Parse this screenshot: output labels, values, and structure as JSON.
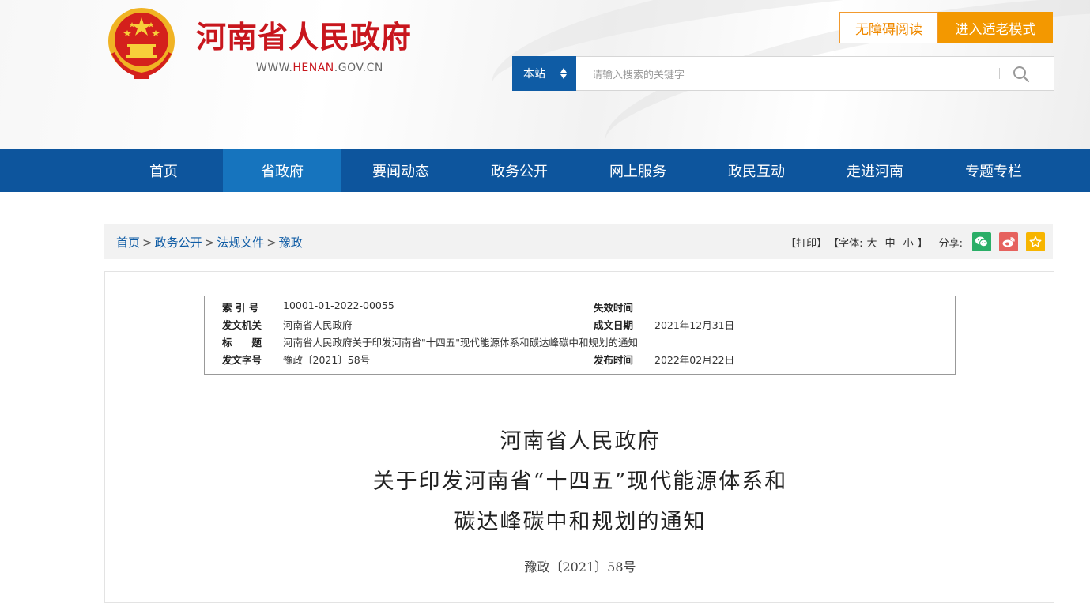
{
  "header": {
    "site_title": "河南省人民政府",
    "url_prefix": "WWW.",
    "url_highlight": "HENAN",
    "url_suffix": ".GOV.CN",
    "accessible_label": "无障碍阅读",
    "elder_mode_label": "进入适老模式",
    "search": {
      "scope": "本站",
      "placeholder": "请输入搜索的关键字"
    }
  },
  "nav": {
    "items": [
      "首页",
      "省政府",
      "要闻动态",
      "政务公开",
      "网上服务",
      "政民互动",
      "走进河南",
      "专题专栏"
    ],
    "active_index": 1
  },
  "breadcrumb": {
    "items": [
      "首页",
      "政务公开",
      "法规文件",
      "豫政"
    ],
    "separator": ">"
  },
  "tools": {
    "print": "【打印】",
    "font_label": "【字体:",
    "font_large": "大",
    "font_medium": "中",
    "font_small": "小",
    "font_close": "】",
    "share_label": "分享:"
  },
  "share_icons": [
    "wechat-icon",
    "weibo-icon",
    "favorite-icon"
  ],
  "colors": {
    "brand_red": "#c8161d",
    "nav_blue": "#0d559d",
    "nav_active": "#1674be",
    "accent_orange": "#f39800",
    "wechat_green": "#2aae67",
    "weibo_red": "#e6625e",
    "favorite_yellow": "#f7b500"
  },
  "meta": {
    "index_label": "索 引 号",
    "index_value": "10001-01-2022-00055",
    "expire_label": "失效时间",
    "expire_value": "",
    "issuer_label": "发文机关",
    "issuer_value": "河南省人民政府",
    "created_label": "成文日期",
    "created_value": "2021年12月31日",
    "title_label": "标　　题",
    "title_value": "河南省人民政府关于印发河南省\"十四五\"现代能源体系和碳达峰碳中和规划的通知",
    "docno_label": "发文字号",
    "docno_value": "豫政〔2021〕58号",
    "published_label": "发布时间",
    "published_value": "2022年02月22日"
  },
  "document": {
    "title_line1": "河南省人民政府",
    "title_line2": "关于印发河南省“十四五”现代能源体系和",
    "title_line3": "碳达峰碳中和规划的通知",
    "doc_number": "豫政〔2021〕58号"
  }
}
